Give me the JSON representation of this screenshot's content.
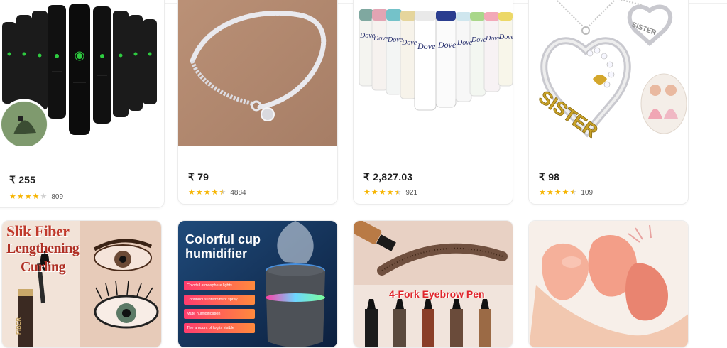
{
  "products": [
    {
      "id": "flashlights",
      "price": "₹ 255",
      "rating_count": "809",
      "stars": 4.0,
      "image_icon": "flashlight-product-image"
    },
    {
      "id": "bracelet",
      "price": "₹ 79",
      "rating_count": "4884",
      "stars": 4.5,
      "image_icon": "bracelet-product-image"
    },
    {
      "id": "deodorant",
      "price": "₹ 2,827.03",
      "rating_count": "921",
      "stars": 4.5,
      "image_icon": "deodorant-product-image"
    },
    {
      "id": "necklace",
      "price": "₹ 98",
      "rating_count": "109",
      "stars": 4.5,
      "image_icon": "necklace-product-image"
    }
  ],
  "row2": {
    "mascara": {
      "line1": "Slik Fiber",
      "line2": "Lengthening",
      "line3": "Curling",
      "tube_label": "FIBER"
    },
    "humidifier": {
      "line1": "Colorful cup",
      "line2": "humidifier",
      "features": [
        "Colorful atmosphere lights",
        "Continuous/intermittent spray",
        "Mute humidification",
        "The amount of fog is visible"
      ]
    },
    "eyebrow": {
      "title": "4-Fork Eyebrow Pen"
    },
    "sponge": {}
  },
  "brand_text": {
    "dove": "Dove",
    "sister": "SISTER",
    "sister_tag": "SISTER"
  },
  "colors": {
    "star": "#f6b400",
    "star_empty": "#cfcfcf",
    "price": "#1e1e1e",
    "mascara_title": "#c0392b",
    "eyebrow_title": "#e0252b"
  }
}
